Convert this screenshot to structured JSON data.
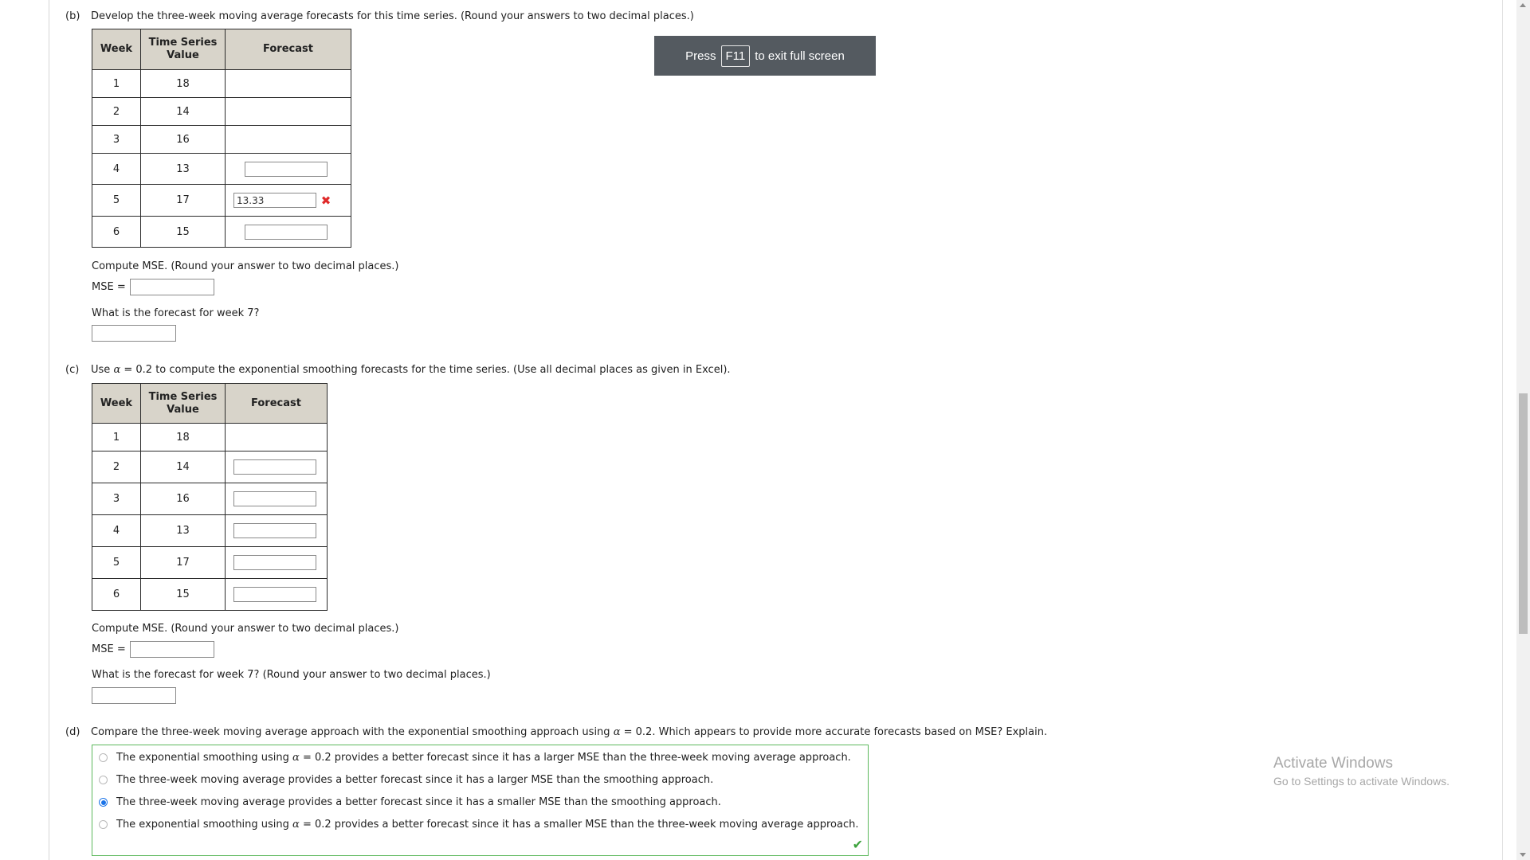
{
  "fullscreen_toast": {
    "press": "Press",
    "key": "F11",
    "suffix": "to exit full screen"
  },
  "part_b": {
    "label": "(b)",
    "question": "Develop the three-week moving average forecasts for this time series. (Round your answers to two decimal places.)",
    "headers": {
      "week": "Week",
      "value_line1": "Time Series",
      "value_line2": "Value",
      "forecast": "Forecast"
    },
    "rows": [
      {
        "week": "1",
        "value": "18"
      },
      {
        "week": "2",
        "value": "14"
      },
      {
        "week": "3",
        "value": "16"
      },
      {
        "week": "4",
        "value": "13",
        "forecast": ""
      },
      {
        "week": "5",
        "value": "17",
        "forecast": "13.33",
        "status": "✖"
      },
      {
        "week": "6",
        "value": "15",
        "forecast": ""
      }
    ],
    "mse_prompt": "Compute MSE. (Round your answer to two decimal places.)",
    "mse_label": "MSE =",
    "week7_prompt": "What is the forecast for week 7?"
  },
  "part_c": {
    "label": "(c)",
    "question_pre": "Use",
    "alpha_symbol": "α",
    "question_post": "= 0.2 to compute the exponential smoothing forecasts for the time series. (Use all decimal places as given in Excel).",
    "headers": {
      "week": "Week",
      "value_line1": "Time Series",
      "value_line2": "Value",
      "forecast": "Forecast"
    },
    "rows": [
      {
        "week": "1",
        "value": "18"
      },
      {
        "week": "2",
        "value": "14",
        "forecast": ""
      },
      {
        "week": "3",
        "value": "16",
        "forecast": ""
      },
      {
        "week": "4",
        "value": "13",
        "forecast": ""
      },
      {
        "week": "5",
        "value": "17",
        "forecast": ""
      },
      {
        "week": "6",
        "value": "15",
        "forecast": ""
      }
    ],
    "mse_prompt": "Compute MSE. (Round your answer to two decimal places.)",
    "mse_label": "MSE =",
    "week7_prompt": "What is the forecast for week 7? (Round your answer to two decimal places.)"
  },
  "part_d": {
    "label": "(d)",
    "question_pre": "Compare the three-week moving average approach with the exponential smoothing approach using",
    "alpha_symbol": "α",
    "question_post": "= 0.2. Which appears to provide more accurate forecasts based on MSE? Explain.",
    "options": [
      {
        "pre": "The exponential smoothing using",
        "alpha": "α",
        "post": "= 0.2 provides a better forecast since it has a larger MSE than the three-week moving average approach.",
        "selected": false
      },
      {
        "pre": "The three-week moving average provides a better forecast since it has a larger MSE than the smoothing approach.",
        "selected": false
      },
      {
        "pre": "The three-week moving average provides a better forecast since it has a smaller MSE than the smoothing approach.",
        "selected": true
      },
      {
        "pre": "The exponential smoothing using",
        "alpha": "α",
        "post": "= 0.2 provides a better forecast since it has a smaller MSE than the three-week moving average approach.",
        "selected": false
      }
    ],
    "result_icon": "✔"
  },
  "watermark": {
    "title": "Activate Windows",
    "subtitle": "Go to Settings to activate Windows."
  },
  "colors": {
    "header_bg": "#d8d4ca",
    "correct": "#5cb85c",
    "incorrect": "#e02a2a",
    "radio_selected": "#1a73e8",
    "toast_bg": "#545a60"
  }
}
